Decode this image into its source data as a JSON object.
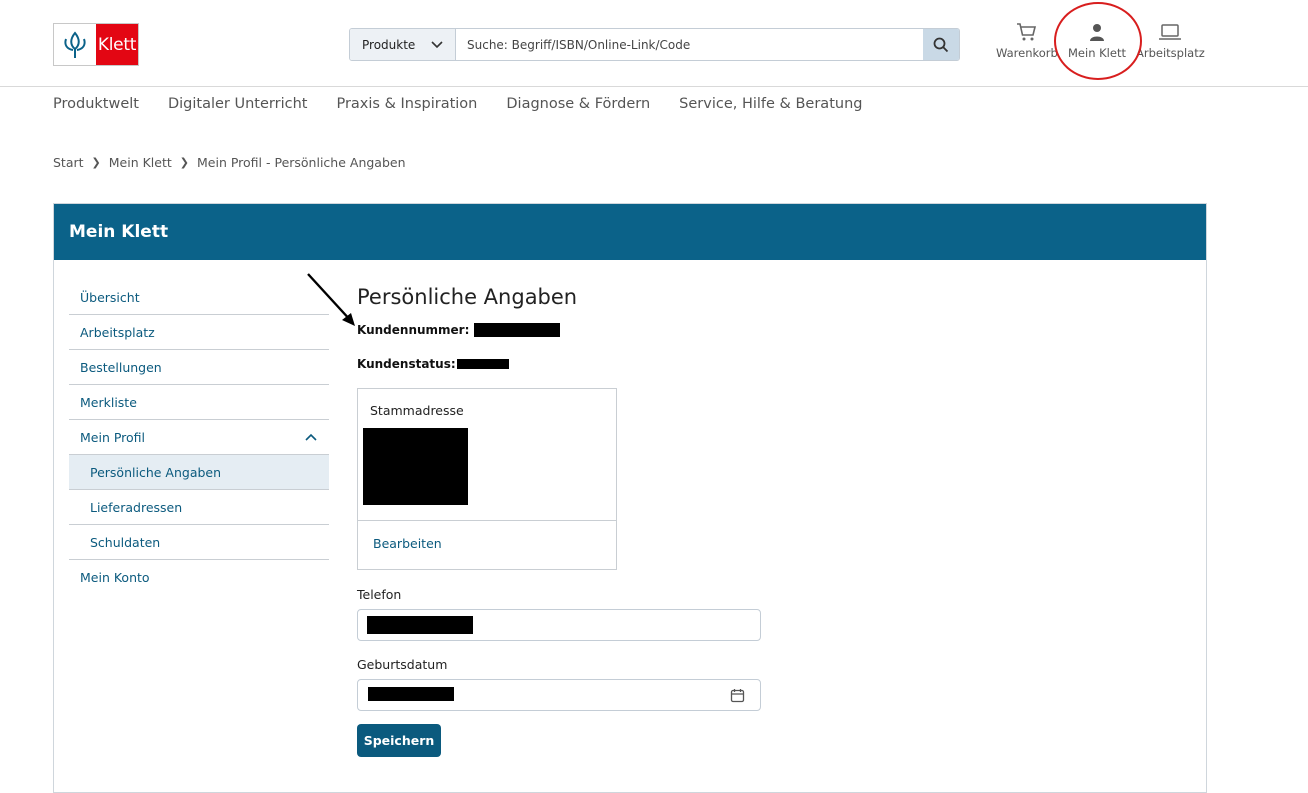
{
  "brand": {
    "logo_text": "Klett",
    "accent": "#e30613",
    "primary": "#0b6289"
  },
  "search": {
    "category": "Produkte",
    "placeholder": "Suche: Begriff/ISBN/Online-Link/Code"
  },
  "header_icons": [
    {
      "icon": "cart-icon",
      "label": "Warenkorb"
    },
    {
      "icon": "user-icon",
      "label": "Mein Klett"
    },
    {
      "icon": "laptop-icon",
      "label": "Arbeitsplatz"
    }
  ],
  "nav": [
    "Produktwelt",
    "Digitaler Unterricht",
    "Praxis & Inspiration",
    "Diagnose & Fördern",
    "Service, Hilfe & Beratung"
  ],
  "breadcrumb": [
    "Start",
    "Mein Klett",
    "Mein Profil - Persönliche Angaben"
  ],
  "panel_title": "Mein Klett",
  "sidebar": [
    {
      "label": "Übersicht",
      "sub": false,
      "active": false
    },
    {
      "label": "Arbeitsplatz",
      "sub": false,
      "active": false
    },
    {
      "label": "Bestellungen",
      "sub": false,
      "active": false
    },
    {
      "label": "Merkliste",
      "sub": false,
      "active": false
    },
    {
      "label": "Mein Profil",
      "sub": false,
      "active": false,
      "expanded": true
    },
    {
      "label": "Persönliche Angaben",
      "sub": true,
      "active": true
    },
    {
      "label": "Lieferadressen",
      "sub": true,
      "active": false
    },
    {
      "label": "Schuldaten",
      "sub": true,
      "active": false
    },
    {
      "label": "Mein Konto",
      "sub": false,
      "active": false
    }
  ],
  "main": {
    "title": "Persönliche Angaben",
    "customer_number_label": "Kundennummer:",
    "customer_status_label": "Kundenstatus:",
    "address_title": "Stammadresse",
    "edit_link": "Bearbeiten",
    "phone_label": "Telefon",
    "birthdate_label": "Geburtsdatum",
    "save_label": "Speichern"
  }
}
